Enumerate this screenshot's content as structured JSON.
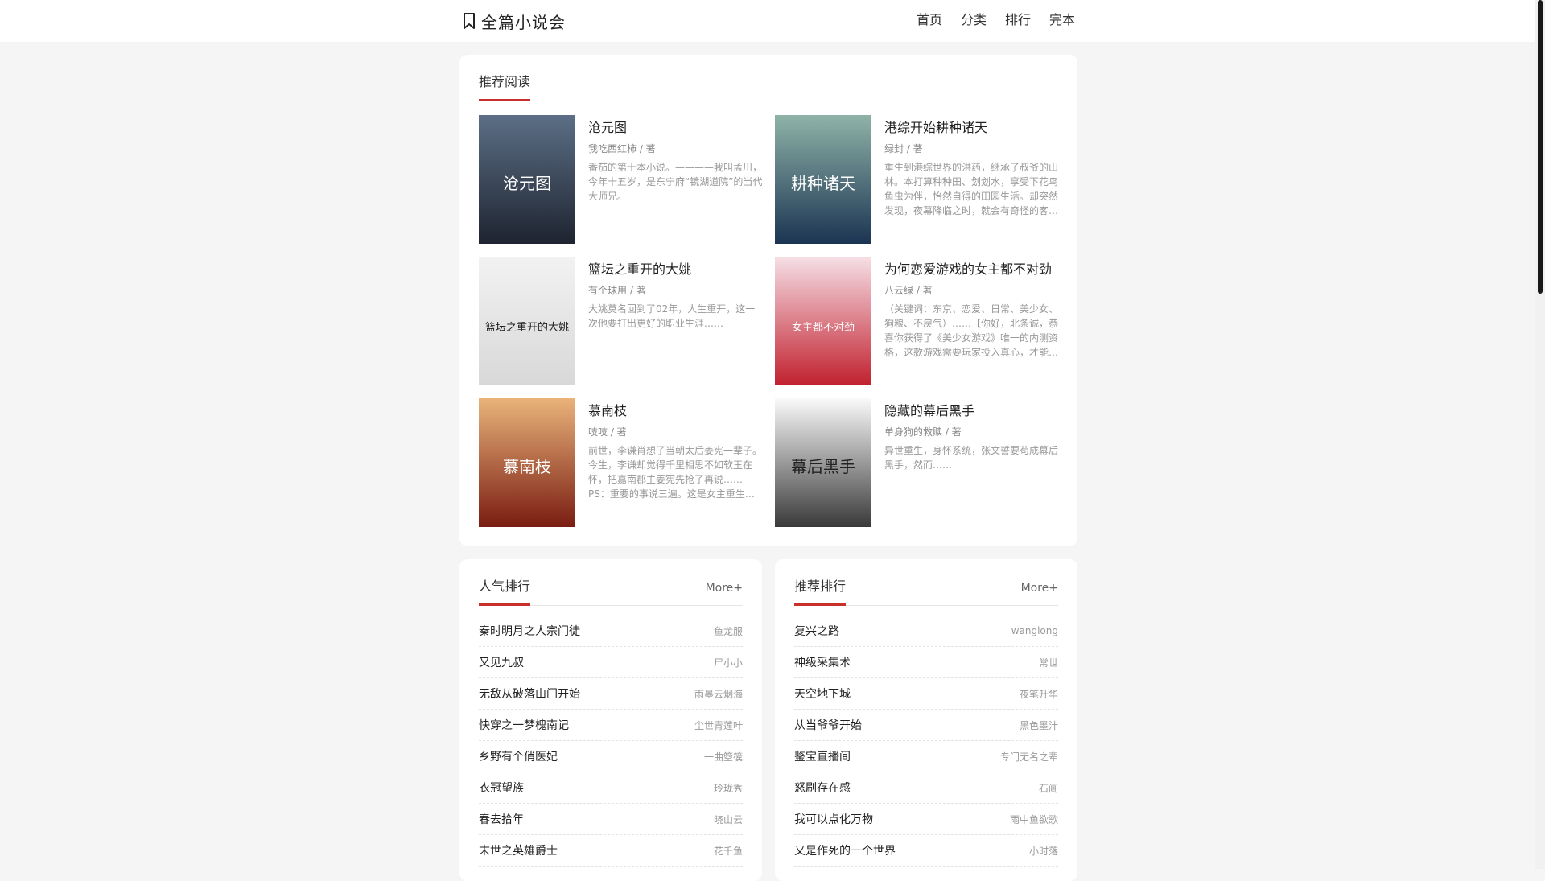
{
  "site": {
    "name": "全篇小说会",
    "nav": [
      "首页",
      "分类",
      "排行",
      "完本"
    ]
  },
  "recommend": {
    "title": "推荐阅读",
    "books": [
      {
        "title": "沧元图",
        "author": "我吃西红柿 / 著",
        "desc": "番茄的第十本小说。————我叫孟川，今年十五岁，是东宁府“镜湖道院”的当代大师兄。",
        "cover_text": "沧元图",
        "cover_colors": [
          "#5c6f86",
          "#1e2430"
        ]
      },
      {
        "title": "港综开始耕种诸天",
        "author": "绿封 / 著",
        "desc": "重生到港综世界的洪药，继承了叔爷的山林。本打算种种田、划划水，享受下花鸟鱼虫为伴，怡然自得的田园生活。却突然发现，夜幕降临之时，就会有奇怪的客…",
        "cover_text": "耕种诸天",
        "cover_colors": [
          "#8fb3a8",
          "#1b3452"
        ]
      },
      {
        "title": "篮坛之重开的大姚",
        "author": "有个球用 / 著",
        "desc": "大姚莫名回到了02年，人生重开，这一次他要打出更好的职业生涯……",
        "cover_text": "篮坛之重开的大姚",
        "cover_colors": [
          "#f2f2f2",
          "#d8d8d8"
        ]
      },
      {
        "title": "为何恋爱游戏的女主都不对劲",
        "author": "八云绿 / 著",
        "desc": "（关键词：东京、恋爱、日常、美少女、狗粮、不戾气）……【你好，北条诚，恭喜你获得了《美少女游戏》唯一的内测资格，这款游戏需要玩家投入真心，才能…",
        "cover_text": "女主都不对劲",
        "cover_colors": [
          "#f6dfe6",
          "#c1202e"
        ]
      },
      {
        "title": "慕南枝",
        "author": "吱吱 / 著",
        "desc": "前世，李谦肖想了当朝太后姜宪一辈子。今生，李谦却觉得千里相思不如软玉在怀，把嘉南郡主姜宪先抢了再说……PS：重要的事说三遍。这是女主重生…",
        "cover_text": "慕南枝",
        "cover_colors": [
          "#e9b37a",
          "#7a1d12"
        ]
      },
      {
        "title": "隐藏的幕后黑手",
        "author": "单身狗的救赎 / 著",
        "desc": "异世重生，身怀系统，张文誓要苟成幕后黑手，然而……",
        "cover_text": "幕后黑手",
        "cover_colors": [
          "#fafafa",
          "#3a3a3a"
        ]
      }
    ]
  },
  "popular": {
    "title": "人气排行",
    "more": "More+",
    "items": [
      {
        "name": "秦时明月之人宗门徒",
        "author": "鱼龙服"
      },
      {
        "name": "又见九叔",
        "author": "尸小小"
      },
      {
        "name": "无敌从破落山门开始",
        "author": "雨墨云烟海"
      },
      {
        "name": "快穿之一梦槐南记",
        "author": "尘世青莲叶"
      },
      {
        "name": "乡野有个俏医妃",
        "author": "一曲箜篌"
      },
      {
        "name": "衣冠望族",
        "author": "玲珑秀"
      },
      {
        "name": "春去拾年",
        "author": "晓山云"
      },
      {
        "name": "末世之英雄爵士",
        "author": "花千鱼"
      }
    ]
  },
  "ranking": {
    "title": "推荐排行",
    "more": "More+",
    "items": [
      {
        "name": "复兴之路",
        "author": "wanglong"
      },
      {
        "name": "神级采集术",
        "author": "常世"
      },
      {
        "name": "天空地下城",
        "author": "夜笔升华"
      },
      {
        "name": "从当爷爷开始",
        "author": "黑色墨汁"
      },
      {
        "name": "鉴宝直播间",
        "author": "专门无名之辈"
      },
      {
        "name": "怒刷存在感",
        "author": "石阃"
      },
      {
        "name": "我可以点化万物",
        "author": "雨中鱼欲歌"
      },
      {
        "name": "又是作死的一个世界",
        "author": "小时落"
      }
    ]
  }
}
